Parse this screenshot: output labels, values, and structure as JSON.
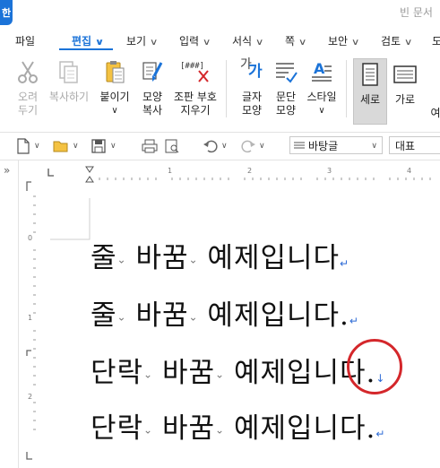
{
  "window": {
    "app_badge": "한",
    "title": "빈 문서"
  },
  "menu": [
    {
      "label": "파일"
    },
    {
      "label": "편집"
    },
    {
      "label": "보기"
    },
    {
      "label": "입력"
    },
    {
      "label": "서식"
    },
    {
      "label": "쪽"
    },
    {
      "label": "보안"
    },
    {
      "label": "검토"
    },
    {
      "label": "도"
    }
  ],
  "ribbon": {
    "cut": {
      "line1": "오려",
      "line2": "두기"
    },
    "copy": {
      "line1": "복사하기"
    },
    "paste": {
      "line1": "붙이기"
    },
    "format_copy": {
      "line1": "모양",
      "line2": "복사"
    },
    "assembled_symbol": {
      "icon_text": "[###]",
      "line1": "조판 부호",
      "line2": "지우기"
    },
    "char_shape": {
      "icon_text": "가",
      "line1": "글자",
      "line2": "모양"
    },
    "para_shape": {
      "line1": "문단",
      "line2": "모양"
    },
    "style": {
      "line1": "스타일"
    },
    "vertical": {
      "line1": "세로"
    },
    "horizontal": {
      "line1": "가로"
    },
    "more": {
      "line1": "여"
    }
  },
  "toolbar": {
    "font_name": "바탕글",
    "style_name": "대표"
  },
  "ruler": {
    "h_numbers": [
      "1",
      "2",
      "3",
      "4"
    ],
    "v_numbers": [
      "0",
      "1",
      "2"
    ]
  },
  "document": {
    "paragraphs": [
      {
        "w1": "줄",
        "w2": "바꿈",
        "w3": "예제입니다",
        "end": "",
        "mark": "↵"
      },
      {
        "w1": "줄",
        "w2": "바꿈",
        "w3": "예제입니다",
        "end": ".",
        "mark": "↵"
      },
      {
        "w1": "단락",
        "w2": "바꿈",
        "w3": "예제입니다",
        "end": ".",
        "mark": "↓"
      },
      {
        "w1": "단락",
        "w2": "바꿈",
        "w3": "예제입니다",
        "end": ".",
        "mark": "↵"
      }
    ],
    "space_marker": "⌄"
  },
  "colors": {
    "accent": "#1b73d8",
    "highlight": "#d4272b",
    "para_mark": "#2d6bd6"
  }
}
